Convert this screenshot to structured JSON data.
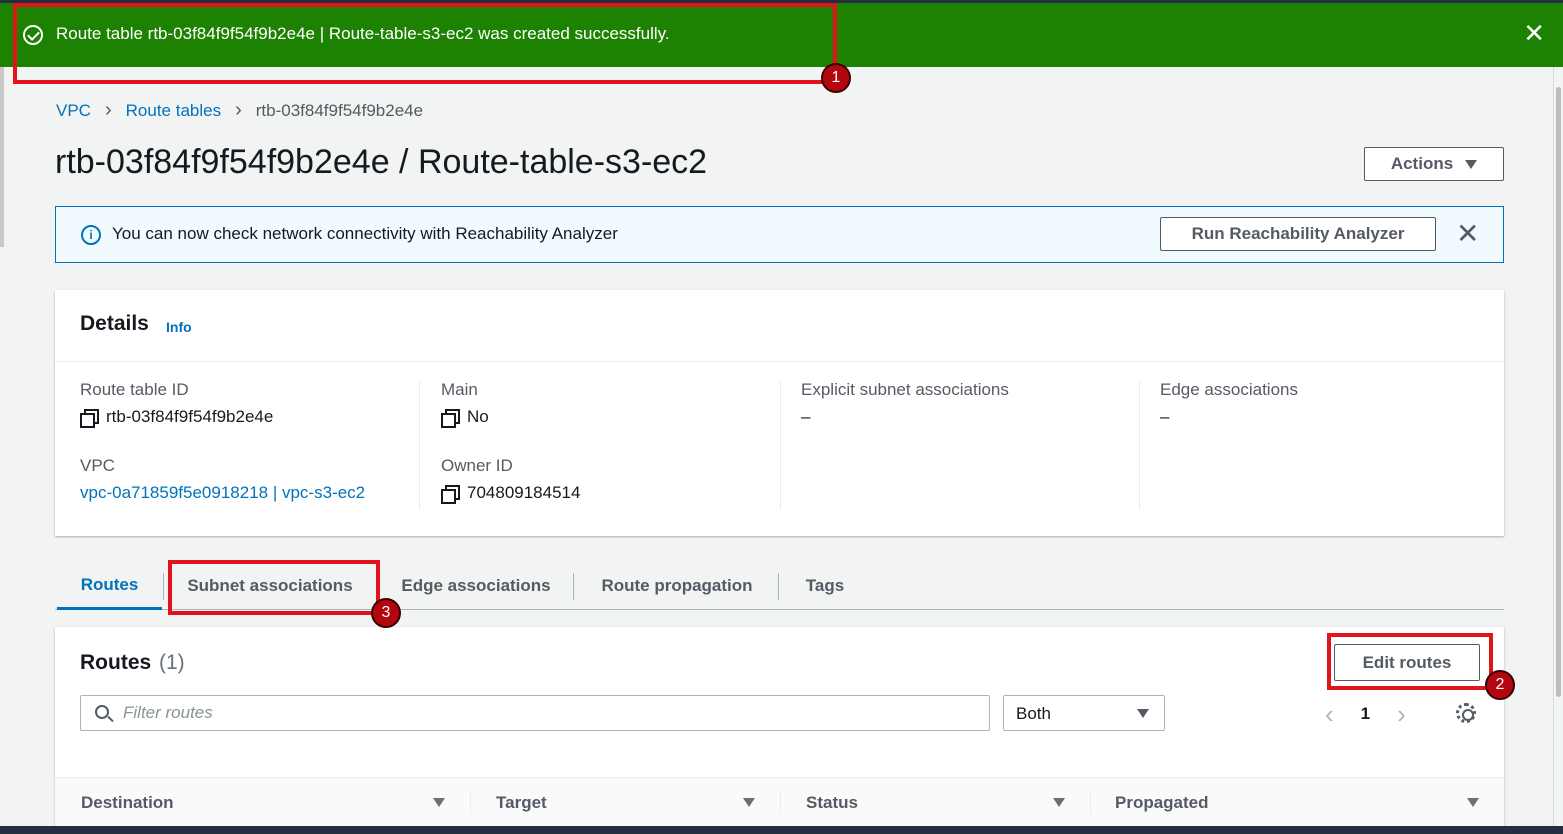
{
  "flash": {
    "message": "Route table rtb-03f84f9f54f9b2e4e | Route-table-s3-ec2 was created successfully.",
    "close_symbol": "✕",
    "icon": "check-circle-icon",
    "color": "#1d8102"
  },
  "breadcrumb": {
    "items": [
      "VPC",
      "Route tables",
      "rtb-03f84f9f54f9b2e4e"
    ],
    "separator": "›"
  },
  "page": {
    "title": "rtb-03f84f9f54f9b2e4e / Route-table-s3-ec2",
    "actions_label": "Actions"
  },
  "info_banner": {
    "icon_glyph": "i",
    "text": "You can now check network connectivity with Reachability Analyzer",
    "button_label": "Run Reachability Analyzer",
    "close_symbol": "✕"
  },
  "details": {
    "title": "Details",
    "info_link": "Info",
    "fields": {
      "route_table_id": {
        "label": "Route table ID",
        "value": "rtb-03f84f9f54f9b2e4e"
      },
      "vpc": {
        "label": "VPC",
        "value": "vpc-0a71859f5e0918218 | vpc-s3-ec2"
      },
      "main": {
        "label": "Main",
        "value": "No"
      },
      "owner_id": {
        "label": "Owner ID",
        "value": "704809184514"
      },
      "explicit_subnet": {
        "label": "Explicit subnet associations",
        "value": "–"
      },
      "edge": {
        "label": "Edge associations",
        "value": "–"
      }
    }
  },
  "tabs": [
    "Routes",
    "Subnet associations",
    "Edge associations",
    "Route propagation",
    "Tags"
  ],
  "routes": {
    "title": "Routes",
    "count": "(1)",
    "edit_label": "Edit routes",
    "filter_placeholder": "Filter routes",
    "select_value": "Both",
    "page_number": "1",
    "prev_symbol": "‹",
    "next_symbol": "›",
    "columns": [
      "Destination",
      "Target",
      "Status",
      "Propagated"
    ]
  },
  "annotations": [
    "1",
    "2",
    "3"
  ],
  "colors": {
    "link": "#0073bb",
    "annotation": "#e0141b",
    "success": "#1d8102"
  }
}
